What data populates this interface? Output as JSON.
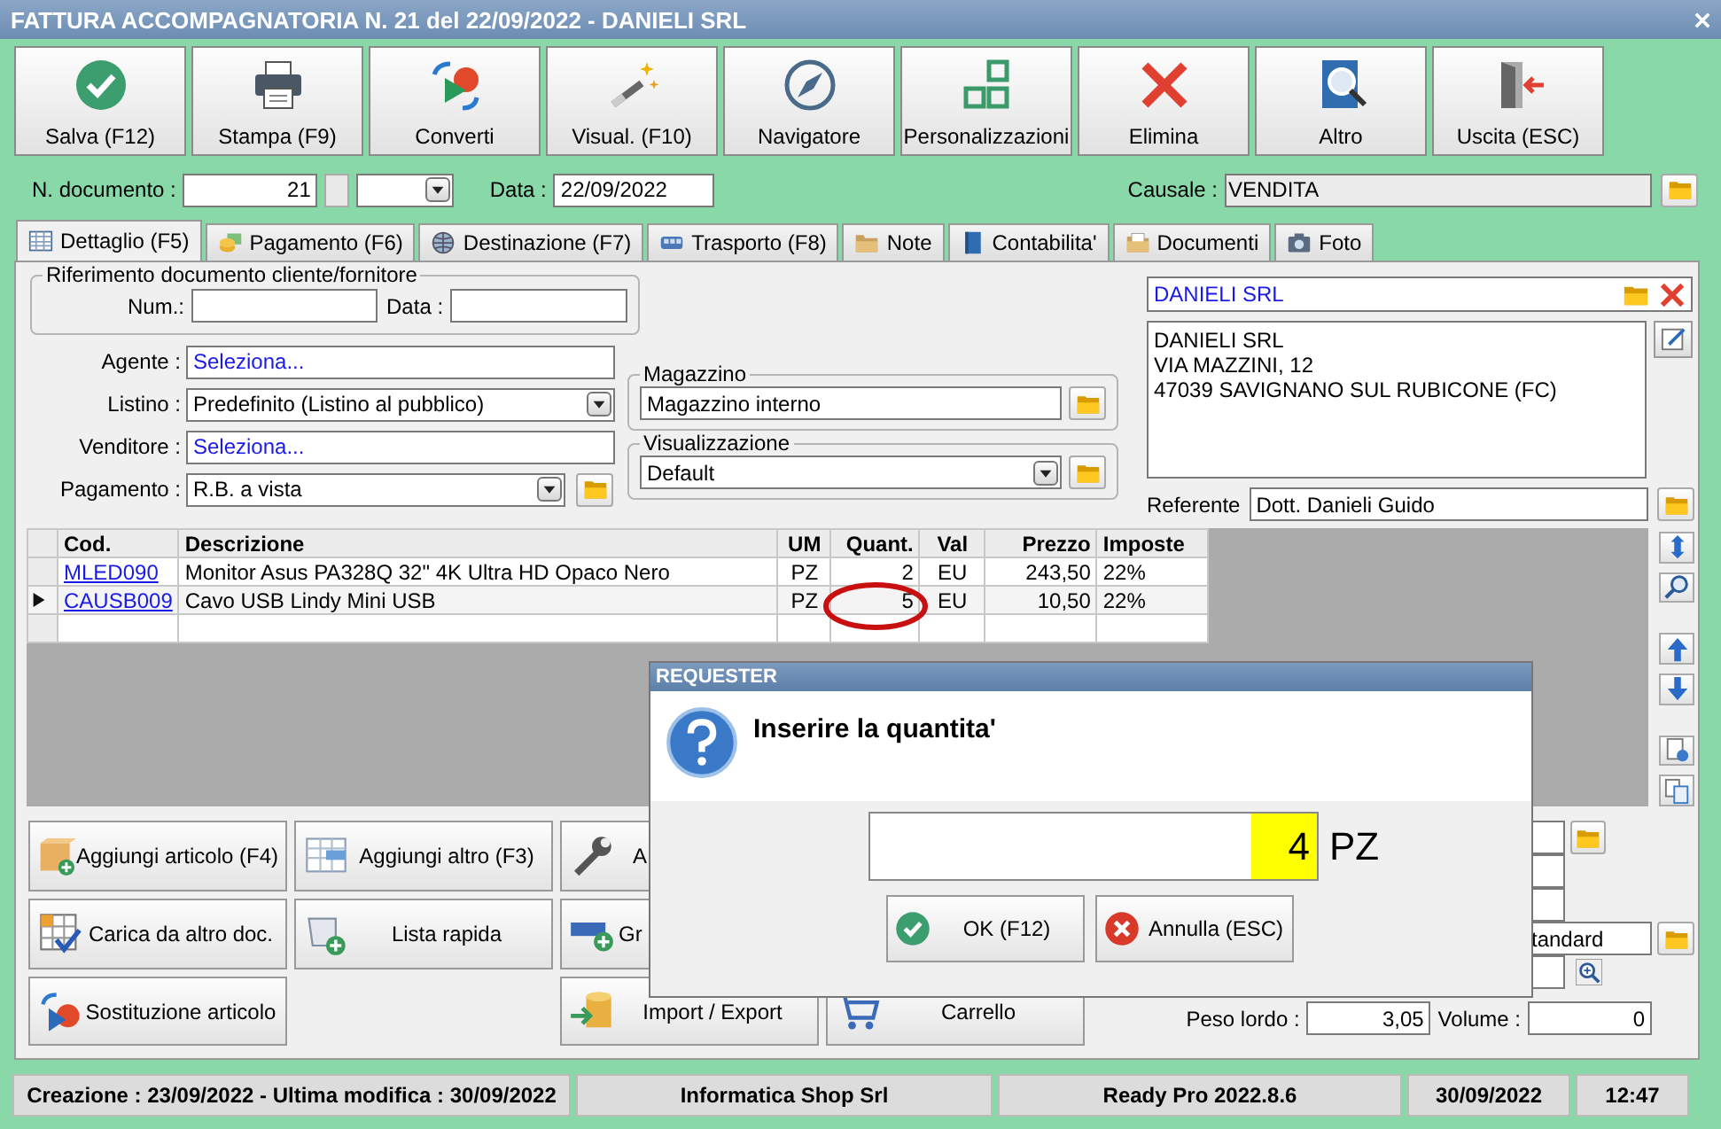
{
  "window": {
    "title": "FATTURA ACCOMPAGNATORIA N. 21 del 22/09/2022 - DANIELI SRL"
  },
  "toolbar": [
    {
      "label": "Salva (F12)",
      "kind": "check"
    },
    {
      "label": "Stampa (F9)",
      "kind": "printer"
    },
    {
      "label": "Converti",
      "kind": "shapes"
    },
    {
      "label": "Visual. (F10)",
      "kind": "wand"
    },
    {
      "label": "Navigatore",
      "kind": "compass"
    },
    {
      "label": "Personalizzazioni",
      "kind": "squares"
    },
    {
      "label": "Elimina",
      "kind": "cross"
    },
    {
      "label": "Altro",
      "kind": "book"
    },
    {
      "label": "Uscita (ESC)",
      "kind": "exit"
    }
  ],
  "header": {
    "doc_number_label": "N. documento :",
    "doc_number": "21",
    "date_label": "Data :",
    "date": "22/09/2022",
    "causale_label": "Causale :",
    "causale": "VENDITA"
  },
  "tabs": [
    {
      "label": "Dettaglio (F5)",
      "selected": true,
      "kind": "grid"
    },
    {
      "label": "Pagamento (F6)",
      "selected": false,
      "kind": "coins"
    },
    {
      "label": "Destinazione (F7)",
      "selected": false,
      "kind": "globe"
    },
    {
      "label": "Trasporto (F8)",
      "selected": false,
      "kind": "bus"
    },
    {
      "label": "Note",
      "selected": false,
      "kind": "note"
    },
    {
      "label": "Contabilita'",
      "selected": false,
      "kind": "book"
    },
    {
      "label": "Documenti",
      "selected": false,
      "kind": "docs"
    },
    {
      "label": "Foto",
      "selected": false,
      "kind": "photo"
    }
  ],
  "reference": {
    "legend": "Riferimento documento cliente/fornitore",
    "num_label": "Num.:",
    "date_label": "Data :"
  },
  "fields": [
    {
      "label": "Agente :",
      "value": "Seleziona...",
      "kind": "link"
    },
    {
      "label": "Listino :",
      "value": "Predefinito (Listino al pubblico)",
      "kind": "combo"
    },
    {
      "label": "Venditore :",
      "value": "Seleziona...",
      "kind": "link"
    },
    {
      "label": "Pagamento :",
      "value": "R.B. a vista",
      "kind": "combo-folder"
    }
  ],
  "magazzino": {
    "legend": "Magazzino",
    "value": "Magazzino interno"
  },
  "visualizzazione": {
    "legend": "Visualizzazione",
    "value": "Default"
  },
  "customer": {
    "name": "DANIELI SRL",
    "address": [
      "DANIELI SRL",
      "VIA MAZZINI, 12",
      "47039 SAVIGNANO SUL RUBICONE (FC)"
    ],
    "referente_label": "Referente",
    "referente": "Dott. Danieli Guido"
  },
  "table": {
    "columns": [
      "Cod.",
      "Descrizione",
      "UM",
      "Quant.",
      "Val",
      "Prezzo",
      "Imposte"
    ],
    "rows": [
      {
        "cells": [
          "MLED090",
          "Monitor Asus PA328Q 32\" 4K Ultra HD Opaco Nero",
          "PZ",
          "2",
          "EU",
          "243,50",
          "22%"
        ],
        "selected": false,
        "circled": false
      },
      {
        "cells": [
          "CAUSB009",
          "Cavo USB Lindy Mini USB",
          "PZ",
          "5",
          "EU",
          "10,50",
          "22%"
        ],
        "selected": true,
        "circled": true
      }
    ]
  },
  "actions": [
    [
      {
        "label": "Aggiungi articolo (F4)",
        "kind": "box-plus"
      },
      {
        "label": "Aggiungi altro (F3)",
        "kind": "table-plus"
      },
      {
        "label": "A",
        "kind": "wrench"
      }
    ],
    [
      {
        "label": "Carica da altro doc.",
        "kind": "grid-check"
      },
      {
        "label": "Lista rapida",
        "kind": "scroll-plus"
      },
      {
        "label": "Gr",
        "kind": "bar-plus"
      }
    ],
    [
      {
        "label": "Sostituzione articolo",
        "kind": "swap"
      },
      {
        "label": "Import / Export",
        "kind": "db-arrow"
      },
      {
        "label": "Carrello",
        "kind": "cart"
      }
    ]
  ],
  "side_fields": {
    "style_value": "tandard",
    "peso_label": "Peso lordo :",
    "peso": "3,05",
    "volume_label": "Volume :",
    "volume": "0"
  },
  "dialog": {
    "title": "REQUESTER",
    "message": "Inserire la quantita'",
    "value": "4",
    "unit": "PZ",
    "buttons": [
      {
        "label": "OK (F12)",
        "kind": "ok"
      },
      {
        "label": "Annulla (ESC)",
        "kind": "cancel"
      }
    ]
  },
  "status_bar": [
    "Creazione : 23/09/2022 - Ultima modifica : 30/09/2022",
    "Informatica Shop Srl",
    "Ready Pro 2022.8.6",
    "30/09/2022",
    "12:47"
  ]
}
